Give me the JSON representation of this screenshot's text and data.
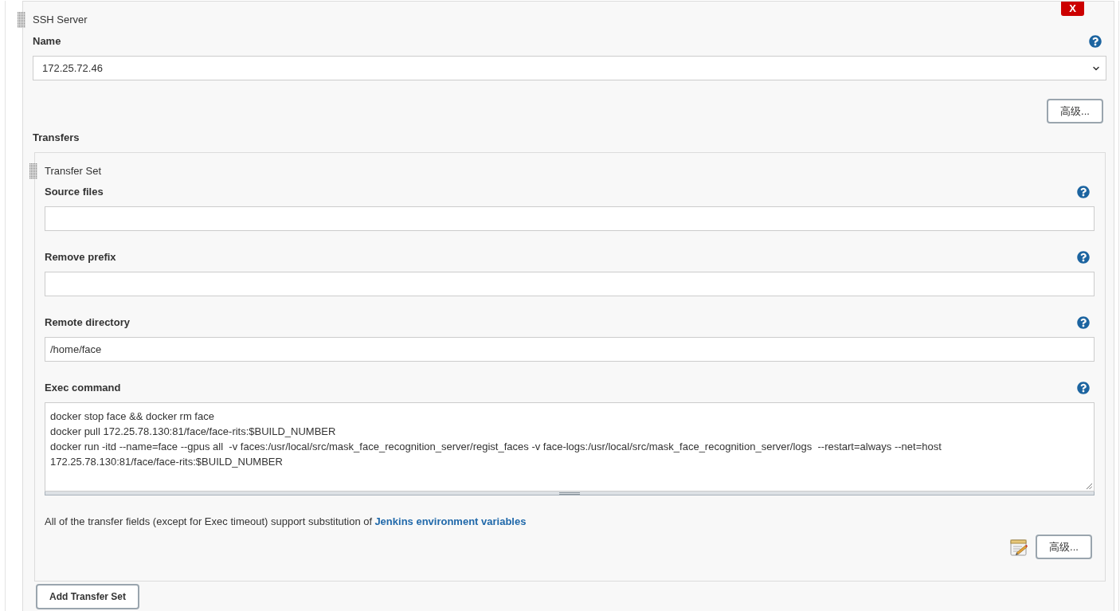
{
  "ssh_server": {
    "title": "SSH Server",
    "delete_label": "X",
    "name": {
      "label": "Name",
      "value": "172.25.72.46"
    },
    "advanced_button": "高级...",
    "transfers_label": "Transfers",
    "transfer_sets": [
      {
        "title": "Transfer Set",
        "fields": [
          {
            "kind": "input",
            "label": "Source files"
          },
          {
            "kind": "input",
            "label": "Remove prefix"
          },
          {
            "kind": "input",
            "label": "Remote directory",
            "value": "/home/face"
          },
          {
            "kind": "textarea",
            "label": "Exec command",
            "value": "docker stop face && docker rm face\ndocker pull 172.25.78.130:81/face/face-rits:$BUILD_NUMBER\ndocker run -itd --name=face --gpus all  -v faces:/usr/local/src/mask_face_recognition_server/regist_faces -v face-logs:/usr/local/src/mask_face_recognition_server/logs  --restart=always --net=host\n172.25.78.130:81/face/face-rits:$BUILD_NUMBER"
          }
        ],
        "note": "All of the transfer fields (except for Exec timeout) support substitution of",
        "note_link": "Jenkins environment variables",
        "advanced_button": "高级..."
      }
    ],
    "add_button": "Add Transfer Set"
  }
}
